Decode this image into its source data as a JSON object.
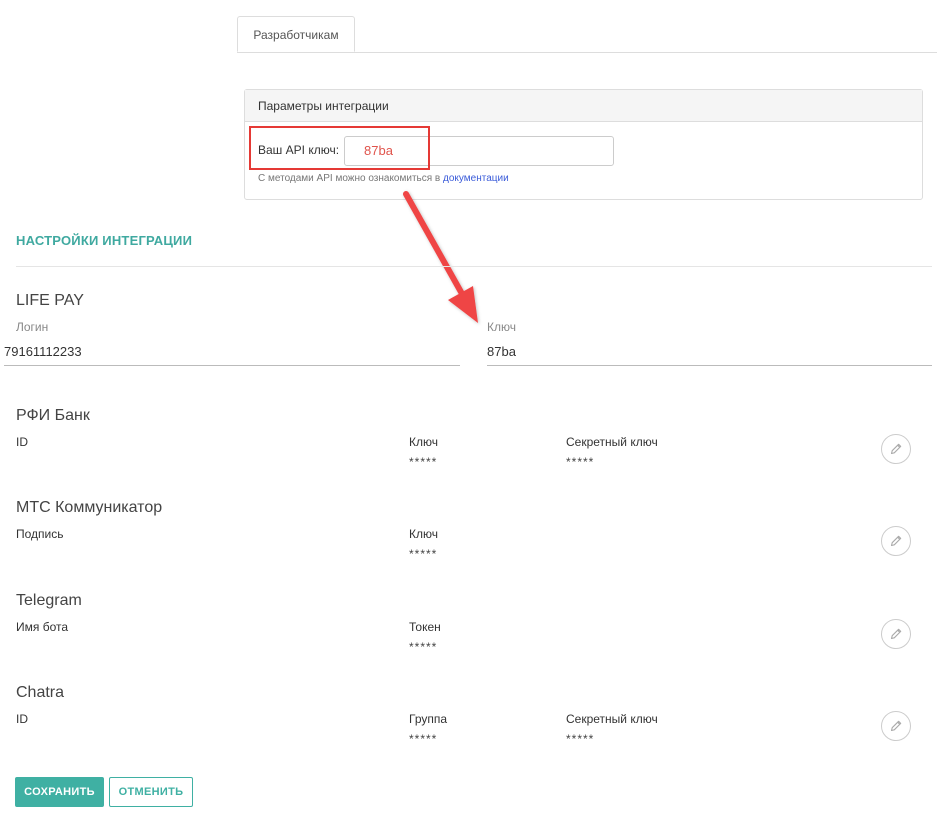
{
  "tabs": [
    {
      "label": "Разработчикам"
    }
  ],
  "api_panel": {
    "title": "Параметры интеграции",
    "key_label": "Ваш API ключ:",
    "key_value": "87ba",
    "docs_note": "С методами API можно ознакомиться в ",
    "docs_link": "документации"
  },
  "section_title": "НАСТРОЙКИ ИНТЕГРАЦИИ",
  "life_pay": {
    "title": "LIFE PAY",
    "login_label": "Логин",
    "login_value": "79161112233",
    "key_label": "Ключ",
    "key_value": "87ba"
  },
  "rfi_bank": {
    "title": "РФИ Банк",
    "id_label": "ID",
    "key_label": "Ключ",
    "key_value": "*****",
    "secret_label": "Секретный ключ",
    "secret_value": "*****"
  },
  "mts": {
    "title": "МТС Коммуникатор",
    "sign_label": "Подпись",
    "key_label": "Ключ",
    "key_value": "*****"
  },
  "telegram": {
    "title": "Telegram",
    "bot_label": "Имя бота",
    "token_label": "Токен",
    "token_value": "*****"
  },
  "chatra": {
    "title": "Chatra",
    "id_label": "ID",
    "group_label": "Группа",
    "group_value": "*****",
    "secret_label": "Секретный ключ",
    "secret_value": "*****"
  },
  "actions": {
    "save": "СОХРАНИТЬ",
    "cancel": "ОТМЕНИТЬ"
  },
  "icons": {
    "edit": "pencil-icon",
    "annotation": "red-arrow-annotation"
  },
  "colors": {
    "accent": "#3fb0a3",
    "heading": "#3fa9a0",
    "highlight": "#e53935",
    "api_value": "#e0544c",
    "link": "#3a5bd9"
  }
}
